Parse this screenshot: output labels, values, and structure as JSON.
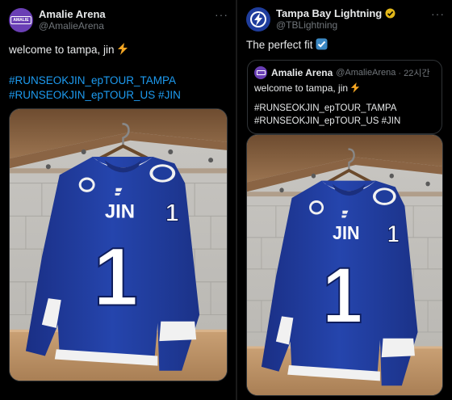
{
  "left_post": {
    "author_name": "Amalie Arena",
    "author_handle": "@AmalieArena",
    "avatar_label": "AMALIE",
    "text": "welcome to tampa, jin",
    "hashtags_line1": "#RUNSEOKJIN_epTOUR_TAMPA",
    "hashtags_line2": "#RUNSEOKJIN_epTOUR_US #JIN",
    "more_label": "···"
  },
  "right_post": {
    "author_name": "Tampa Bay Lightning",
    "author_handle": "@TBLightning",
    "text": "The perfect fit",
    "more_label": "···",
    "quote": {
      "author_name": "Amalie Arena",
      "author_handle": "@AmalieArena",
      "time": "· 22시간",
      "text": "welcome to tampa, jin",
      "hashtags_line1": "#RUNSEOKJIN_epTOUR_TAMPA",
      "hashtags_line2": "#RUNSEOKJIN_epTOUR_US #JIN"
    }
  },
  "jersey": {
    "name": "JIN",
    "number": "1",
    "sleeve_number": "1"
  },
  "colors": {
    "background": "#000000",
    "text": "#e7e9ea",
    "muted": "#71767b",
    "hashtag": "#1d9bf0",
    "amalie_purple": "#6a3fb5",
    "lightning_blue": "#1f3d9c",
    "jersey_blue": "#223fa3",
    "gold_badge": "#e2b719"
  },
  "icons": [
    "more-icon",
    "verified-badge-icon",
    "lightning-bolt-emoji",
    "check-box-emoji",
    "lightning-logo-icon"
  ]
}
